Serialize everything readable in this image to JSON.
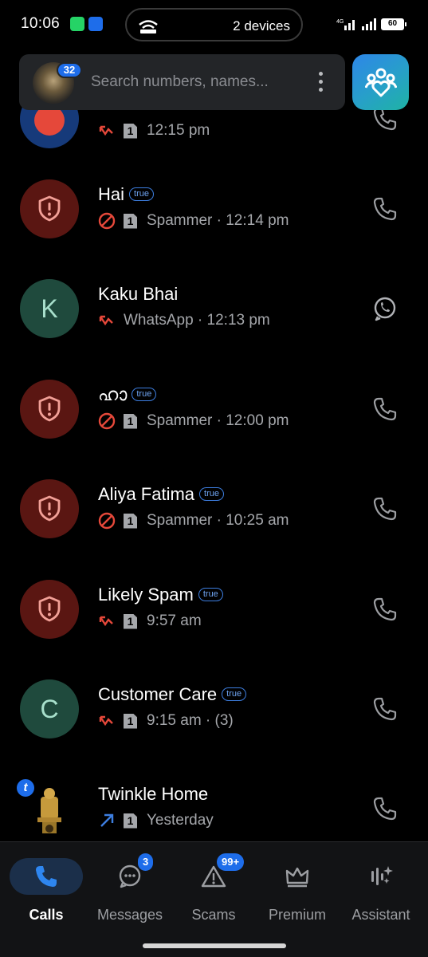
{
  "status_bar": {
    "time": "10:06",
    "devices_label": "2 devices",
    "network": "4G",
    "battery": "60"
  },
  "search": {
    "placeholder": "Search numbers, names...",
    "notification_count": "32"
  },
  "calls": [
    {
      "name": "",
      "meta": "12:15 pm",
      "type": "missed",
      "sim": "1",
      "avatar": "blue",
      "badge": false,
      "action": "phone-icon"
    },
    {
      "name": "Hai",
      "meta": "Spammer · 12:14 pm",
      "type": "blocked",
      "sim": "1",
      "avatar": "spam",
      "badge": true,
      "action": "phone-icon"
    },
    {
      "name": "Kaku Bhai",
      "meta": "WhatsApp · 12:13 pm",
      "type": "missed",
      "sim": "",
      "avatar": "K",
      "badge": false,
      "action": "whatsapp-icon"
    },
    {
      "name": "ഹാ",
      "meta": "Spammer · 12:00 pm",
      "type": "blocked",
      "sim": "1",
      "avatar": "spam",
      "badge": true,
      "action": "phone-icon"
    },
    {
      "name": "Aliya Fatima",
      "meta": "Spammer · 10:25 am",
      "type": "blocked",
      "sim": "1",
      "avatar": "spam",
      "badge": true,
      "action": "phone-icon"
    },
    {
      "name": "Likely Spam",
      "meta": "9:57 am",
      "type": "missed",
      "sim": "1",
      "avatar": "spam",
      "badge": true,
      "action": "phone-icon"
    },
    {
      "name": "Customer Care",
      "meta": "9:15 am · (3)",
      "type": "missed",
      "sim": "1",
      "avatar": "C",
      "badge": true,
      "action": "phone-icon"
    },
    {
      "name": "Twinkle Home",
      "meta": "Yesterday",
      "type": "outgoing",
      "sim": "1",
      "avatar": "emblem",
      "badge": false,
      "action": "phone-icon"
    }
  ],
  "true_badge_label": "true",
  "nav": [
    {
      "label": "Calls",
      "active": true,
      "icon": "phone-icon"
    },
    {
      "label": "Messages",
      "active": false,
      "icon": "message-icon",
      "badge": "3"
    },
    {
      "label": "Scams",
      "active": false,
      "icon": "warning-icon",
      "badge": "99+"
    },
    {
      "label": "Premium",
      "active": false,
      "icon": "crown-icon"
    },
    {
      "label": "Assistant",
      "active": false,
      "icon": "assistant-icon"
    }
  ],
  "colors": {
    "accent": "#1e6dea",
    "missed": "#e5483a",
    "outgoing": "#3d7ee0",
    "spam_avatar": "#5a1612",
    "letter_avatar": "#1f4a3d"
  }
}
